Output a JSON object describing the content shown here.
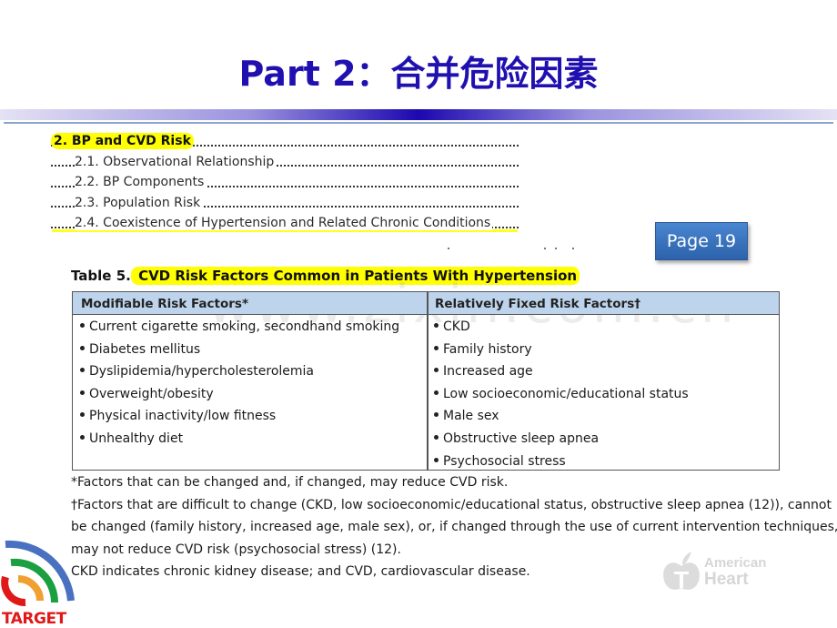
{
  "slide": {
    "title": "Part 2：合并危险因素"
  },
  "toc": {
    "items": [
      {
        "label": "2. BP and CVD Risk",
        "level": "main",
        "highlighted": true
      },
      {
        "label": "2.1. Observational Relationship",
        "level": "sub"
      },
      {
        "label": "2.2. BP Components",
        "level": "sub"
      },
      {
        "label": "2.3. Population Risk",
        "level": "sub"
      },
      {
        "label": "2.4. Coexistence of Hypertension and Related Chronic Conditions",
        "level": "sub"
      }
    ]
  },
  "page_badge": {
    "label": "Page 19"
  },
  "table": {
    "caption_prefix": "Table 5.",
    "caption_title": " CVD Risk Factors Common in Patients With Hypertension",
    "headers": [
      "Modifiable Risk Factors*",
      "Relatively Fixed Risk Factors†"
    ],
    "modifiable": [
      "Current cigarette smoking, secondhand smoking",
      "Diabetes mellitus",
      "Dyslipidemia/hypercholesterolemia",
      "Overweight/obesity",
      "Physical inactivity/low fitness",
      "Unhealthy diet"
    ],
    "fixed": [
      "CKD",
      "Family history",
      "Increased age",
      "Low socioeconomic/educational status",
      "Male sex",
      "Obstructive sleep apnea",
      "Psychosocial stress"
    ]
  },
  "footnotes": [
    "*Factors that can be changed and, if changed, may reduce CVD risk.",
    "†Factors that are difficult to change (CKD, low socioeconomic/educational status, obstructive sleep apnea (12)), cannot",
    "be changed (family history, increased age, male sex), or, if changed through the use of current intervention techniques,",
    "may not reduce CVD risk (psychosocial stress) (12).",
    "CKD indicates chronic kidney disease; and CVD, cardiovascular disease."
  ],
  "watermark": "www.zixin.com.cn",
  "aha_logo": {
    "line1": "American",
    "line2": "Heart"
  },
  "target_logo": {
    "label": "TARGET"
  },
  "colors": {
    "title": "#2010b0",
    "highlight": "#ffff00",
    "table_header": "#bed4ec",
    "badge": "#3a72bd",
    "target_red": "#e01818"
  }
}
